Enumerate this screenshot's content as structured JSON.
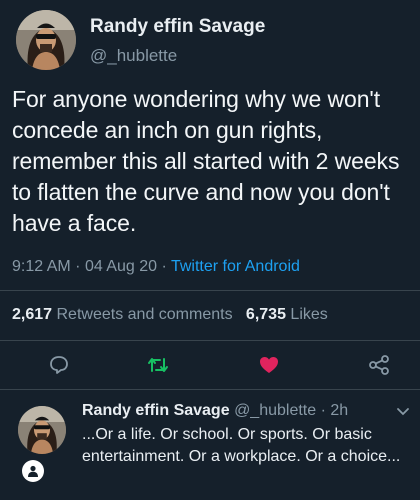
{
  "tweet": {
    "author_name": "Randy effin Savage",
    "author_handle": "@_hublette",
    "text": "For anyone wondering why we won't concede an inch on gun rights, remember this all started with 2 weeks to flatten the curve and now you don't have a face.",
    "time": "9:12 AM",
    "date": "04 Aug 20",
    "separator": "·",
    "source": "Twitter for Android",
    "retweets": "2,617",
    "retweets_label": "Retweets and comments",
    "likes": "6,735",
    "likes_label": "Likes"
  },
  "reply": {
    "author_name": "Randy effin Savage",
    "author_handle": "@_hublette",
    "separator": "·",
    "time": "2h",
    "text": "...Or a life. Or school. Or sports. Or basic entertainment. Or a workplace. Or a choice..."
  },
  "colors": {
    "background": "#15202b",
    "secondary_text": "#8899a6",
    "link": "#1da1f2",
    "like_active": "#e0245e",
    "retweet": "#17bf63",
    "divider": "#38444d"
  },
  "icons": {
    "reply": "speech-bubble-icon",
    "retweet": "retweet-icon",
    "like": "heart-icon",
    "share": "share-icon",
    "more": "chevron-down-icon"
  }
}
